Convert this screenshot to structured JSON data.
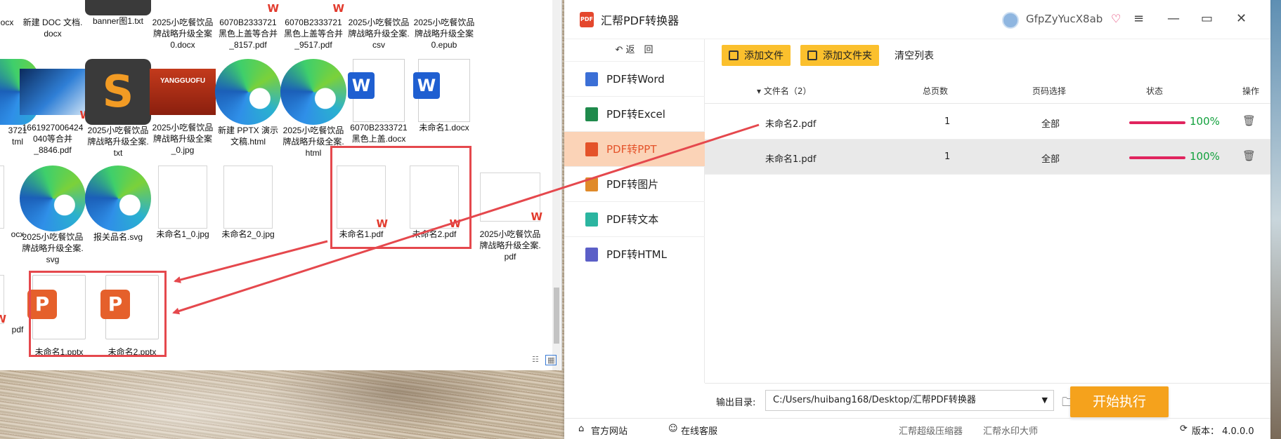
{
  "explorer": {
    "files": [
      {
        "label": "ocx"
      },
      {
        "label": "新建 DOC 文档.\ndocx"
      },
      {
        "label": "banner图1.txt"
      },
      {
        "label": "2025小吃餐饮品\n牌战略升级全案\n0.docx"
      },
      {
        "label": "6070B2333721\n黑色上盖等合并\n_8157.pdf"
      },
      {
        "label": "6070B2333721\n黑色上盖等合并\n_9517.pdf"
      },
      {
        "label": "2025小吃餐饮品\n牌战略升级全案.\ncsv"
      },
      {
        "label": "2025小吃餐饮品\n牌战略升级全案\n0.epub"
      },
      {
        "label": "3721\ntml"
      },
      {
        "label": "1661927006424\n040等合并\n_8846.pdf"
      },
      {
        "label": "2025小吃餐饮品\n牌战略升级全案.\ntxt"
      },
      {
        "label": "2025小吃餐饮品\n牌战略升级全案\n_0.jpg"
      },
      {
        "label": "新建 PPTX 演示\n文稿.html"
      },
      {
        "label": "2025小吃餐饮品\n牌战略升级全案.\nhtml"
      },
      {
        "label": "6070B2333721\n黑色上盖.docx"
      },
      {
        "label": "未命名1.docx"
      },
      {
        "label": "ocx"
      },
      {
        "label": "2025小吃餐饮品\n牌战略升级全案.\nsvg"
      },
      {
        "label": "报关品名.svg"
      },
      {
        "label": "未命名1_0.jpg"
      },
      {
        "label": "未命名2_0.jpg"
      },
      {
        "label": "未命名1.pdf"
      },
      {
        "label": "未命名2.pdf"
      },
      {
        "label": "2025小吃餐饮品\n牌战略升级全案.\npdf"
      },
      {
        "label": "pdf"
      },
      {
        "label": "未命名1.pptx"
      },
      {
        "label": "未命名2.pptx"
      }
    ],
    "jpg_thumb_text": "YANGGUOFU"
  },
  "app": {
    "title": "汇帮PDF转换器",
    "username": "GfpZyYucX8ab",
    "back_label": "↶ 返　回",
    "sidebar": [
      {
        "label": "PDF转Word",
        "color": "#3b6fd6"
      },
      {
        "label": "PDF转Excel",
        "color": "#1f8a4c"
      },
      {
        "label": "PDF转PPT",
        "color": "#e4532a",
        "active": true
      },
      {
        "label": "PDF转图片",
        "color": "#e08a2a"
      },
      {
        "label": "PDF转文本",
        "color": "#2bb5a0"
      },
      {
        "label": "PDF转HTML",
        "color": "#5b5fc7"
      }
    ],
    "toolbar": {
      "add_file": "添加文件",
      "add_folder": "添加文件夹",
      "clear_list": "清空列表"
    },
    "table": {
      "headers": {
        "filename": "▾ 文件名（2）",
        "pages": "总页数",
        "page_select": "页码选择",
        "status": "状态",
        "action": "操作"
      },
      "rows": [
        {
          "filename": "未命名2.pdf",
          "pages": "1",
          "page_select": "全部",
          "progress": 100,
          "progress_label": "100%"
        },
        {
          "filename": "未命名1.pdf",
          "pages": "1",
          "page_select": "全部",
          "progress": 100,
          "progress_label": "100%"
        }
      ]
    },
    "output": {
      "label": "输出目录:",
      "path": "C:/Users/huibang168/Desktop/汇帮PDF转换器"
    },
    "start_button": "开始执行",
    "statusbar": {
      "website": "官方网站",
      "support": "在线客服",
      "compressor": "汇帮超级压缩器",
      "watermark": "汇帮水印大师",
      "version": "版本： 4.0.0.0"
    },
    "colors": {
      "accent": "#f5a21c",
      "active_bg": "#fbd3b7",
      "progress": "#e0245e",
      "success": "#12a13d"
    }
  }
}
